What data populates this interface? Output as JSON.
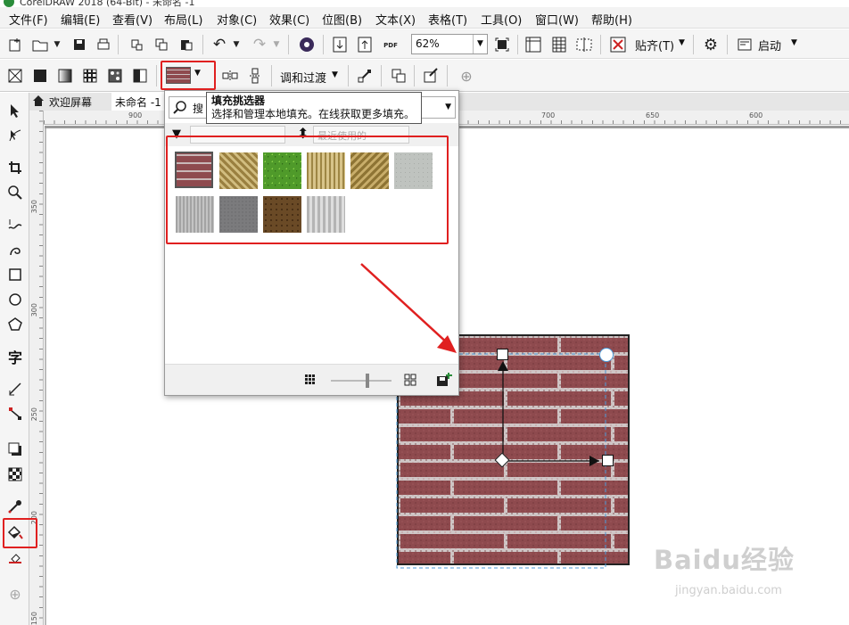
{
  "window": {
    "title": "CorelDRAW 2018 (64-Bit) - 未命名 -1"
  },
  "menu": [
    "文件(F)",
    "编辑(E)",
    "查看(V)",
    "布局(L)",
    "对象(C)",
    "效果(C)",
    "位图(B)",
    "文本(X)",
    "表格(T)",
    "工具(O)",
    "窗口(W)",
    "帮助(H)"
  ],
  "toolbar": {
    "zoom_value": "62%",
    "snap_label": "贴齐(T)",
    "launch_label": "启动",
    "pdf_label": "PDF"
  },
  "propbar": {
    "blend_label": "调和过渡"
  },
  "tabs": {
    "welcome": "欢迎屏幕",
    "document": "未命名 -1"
  },
  "ruler": {
    "h_ticks": [
      "900",
      "700",
      "650",
      "600"
    ],
    "v_ticks": [
      "350",
      "300",
      "250",
      "200",
      "150"
    ]
  },
  "tooltip": {
    "title": "填充挑选器",
    "description": "选择和管理本地填充。在线获取更多填充。"
  },
  "popup": {
    "search_placeholder": "搜",
    "filter1": "",
    "filter2": "最近使用的"
  },
  "colors": {
    "highlight": "#e02020",
    "accent": "#2a8c3a",
    "brick": "#8e4a4e"
  },
  "watermark": {
    "brand": "Baidu经验",
    "url": "jingyan.baidu.com"
  }
}
